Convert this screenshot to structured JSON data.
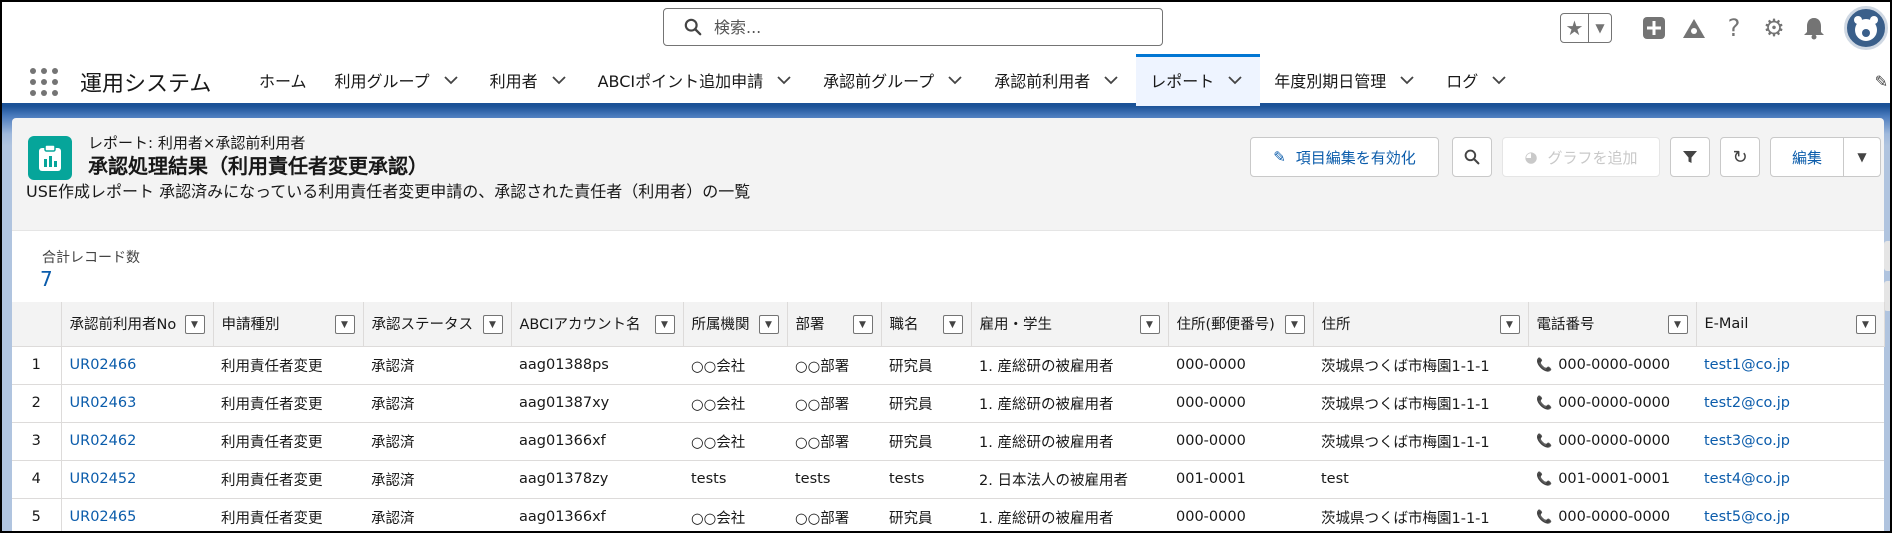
{
  "header": {
    "search_placeholder": "検索..."
  },
  "nav": {
    "app_name": "運用システム",
    "items": [
      {
        "label": "ホーム",
        "has_menu": false
      },
      {
        "label": "利用グループ",
        "has_menu": true
      },
      {
        "label": "利用者",
        "has_menu": true
      },
      {
        "label": "ABCIポイント追加申請",
        "has_menu": true
      },
      {
        "label": "承認前グループ",
        "has_menu": true
      },
      {
        "label": "承認前利用者",
        "has_menu": true
      },
      {
        "label": "レポート",
        "has_menu": true,
        "active": true
      },
      {
        "label": "年度別期日管理",
        "has_menu": true
      },
      {
        "label": "ログ",
        "has_menu": true
      }
    ]
  },
  "report": {
    "type_label": "レポート: 利用者×承認前利用者",
    "title": "承認処理結果（利用責任者変更承認）",
    "description": "USE作成レポート 承認済みになっている利用責任者変更申請の、承認された責任者（利用者）の一覧",
    "buttons": {
      "inline_edit": "項目編集を有効化",
      "add_chart": "グラフを追加",
      "edit": "編集"
    },
    "total_label": "合計レコード数",
    "total_value": "7"
  },
  "table": {
    "columns": [
      "承認前利用者No",
      "申請種別",
      "承認ステータス",
      "ABCIアカウント名",
      "所属機関",
      "部署",
      "職名",
      "雇用・学生",
      "住所(郵便番号)",
      "住所",
      "電話番号",
      "E-Mail"
    ],
    "rows": [
      [
        "1",
        "UR02466",
        "利用責任者変更",
        "承認済",
        "aag01388ps",
        "○○会社",
        "○○部署",
        "研究員",
        "1. 産総研の被雇用者",
        "000-0000",
        "茨城県つくば市梅園1-1-1",
        "000-0000-0000",
        "test1@co.jp"
      ],
      [
        "2",
        "UR02463",
        "利用責任者変更",
        "承認済",
        "aag01387xy",
        "○○会社",
        "○○部署",
        "研究員",
        "1. 産総研の被雇用者",
        "000-0000",
        "茨城県つくば市梅園1-1-1",
        "000-0000-0000",
        "test2@co.jp"
      ],
      [
        "3",
        "UR02462",
        "利用責任者変更",
        "承認済",
        "aag01366xf",
        "○○会社",
        "○○部署",
        "研究員",
        "1. 産総研の被雇用者",
        "000-0000",
        "茨城県つくば市梅園1-1-1",
        "000-0000-0000",
        "test3@co.jp"
      ],
      [
        "4",
        "UR02452",
        "利用責任者変更",
        "承認済",
        "aag01378zy",
        "tests",
        "tests",
        "tests",
        "2. 日本法人の被雇用者",
        "001-0001",
        "test",
        "001-0001-0001",
        "test4@co.jp"
      ],
      [
        "5",
        "UR02465",
        "利用責任者変更",
        "承認済",
        "aag01366xf",
        "○○会社",
        "○○部署",
        "研究員",
        "1. 産総研の被雇用者",
        "000-0000",
        "茨城県つくば市梅園1-1-1",
        "000-0000-0000",
        "test5@co.jp"
      ]
    ]
  },
  "colors": {
    "brand_blue": "#1b5297",
    "link_blue": "#0b5cab",
    "report_icon": "#06a59a"
  }
}
